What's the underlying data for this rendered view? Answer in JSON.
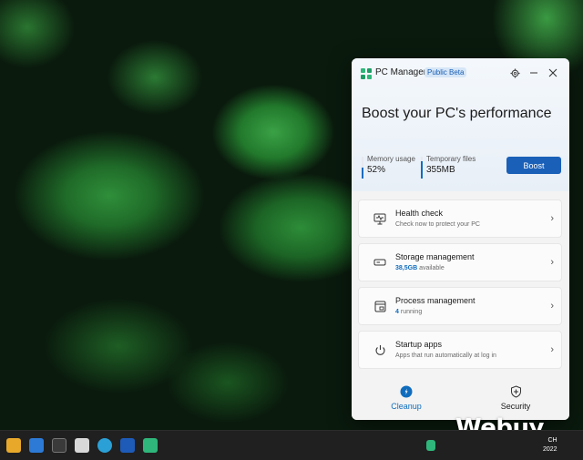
{
  "app": {
    "title": "PC Manager",
    "badge": "Public Beta"
  },
  "titlebar": {
    "settings_icon": "gear-icon",
    "minimize_icon": "minimize-icon",
    "close_icon": "close-icon"
  },
  "hero": {
    "headline": "Boost your PC's performance",
    "memory": {
      "label": "Memory usage",
      "value": "52%",
      "level": 0.52
    },
    "temp_files": {
      "label": "Temporary files",
      "value": "355MB"
    },
    "boost_label": "Boost"
  },
  "cards": [
    {
      "icon": "monitor-check-icon",
      "title": "Health check",
      "subtitle": "Check now to protect your PC"
    },
    {
      "icon": "storage-icon",
      "title": "Storage management",
      "subtitle_value": "38,5GB",
      "subtitle_text": "available"
    },
    {
      "icon": "process-icon",
      "title": "Process management",
      "subtitle_value": "4",
      "subtitle_text": "running"
    },
    {
      "icon": "power-icon",
      "title": "Startup apps",
      "subtitle": "Apps that run automatically at log in"
    }
  ],
  "nav": {
    "cleanup": "Cleanup",
    "security": "Security"
  },
  "taskbar": {
    "clock_time": "CH",
    "clock_date": "2022"
  },
  "watermark": "Webuy",
  "colors": {
    "accent": "#0f6cbd",
    "boost": "#1a60b8",
    "taskbar": "#202020"
  }
}
